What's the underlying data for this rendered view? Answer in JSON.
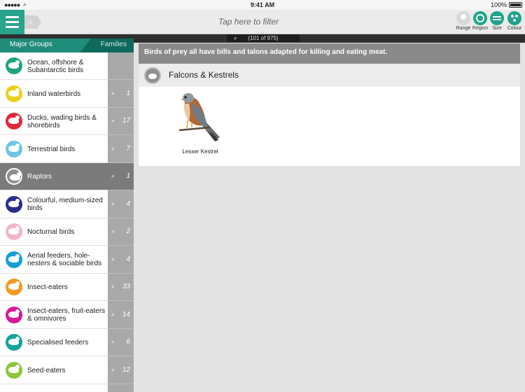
{
  "status_bar": {
    "carrier": "●●●●●",
    "time": "9:41 AM",
    "battery": "100%"
  },
  "toolbar": {
    "filter_placeholder": "Tap here to filter",
    "buttons": [
      {
        "label": "Range",
        "icon": "range-pin-icon"
      },
      {
        "label": "Region",
        "icon": "region-target-icon"
      },
      {
        "label": "Size",
        "icon": "size-bars-icon"
      },
      {
        "label": "Colour",
        "icon": "colour-palette-icon"
      }
    ]
  },
  "count": "(101 of 975)",
  "sidebar": {
    "tab_major": "Major Groups",
    "tab_families": "Families",
    "items": [
      {
        "label": "Ocean, offshore & Subantarctic birds",
        "count": "",
        "color": "#1fa37e",
        "selected": false
      },
      {
        "label": "Inland waterbirds",
        "count": "1",
        "color": "#e8d21c",
        "selected": false
      },
      {
        "label": "Ducks, wading birds & shorebirds",
        "count": "17",
        "color": "#e02a3a",
        "selected": false
      },
      {
        "label": "Terrestrial birds",
        "count": "7",
        "color": "#6fc3e8",
        "selected": false
      },
      {
        "label": "Raptors",
        "count": "1",
        "color": "#8f8f8f",
        "selected": true
      },
      {
        "label": "Colourful, medium-sized birds",
        "count": "4",
        "color": "#2b2c8c",
        "selected": false
      },
      {
        "label": "Nocturnal birds",
        "count": "2",
        "color": "#f3b5c6",
        "selected": false
      },
      {
        "label": "Aerial feeders, hole-nesters & sociable birds",
        "count": "4",
        "color": "#1a9ed8",
        "selected": false
      },
      {
        "label": "Insect-eaters",
        "count": "33",
        "color": "#f29a26",
        "selected": false
      },
      {
        "label": "Insect-eaters, fruit-eaters & omnivores",
        "count": "14",
        "color": "#d6189a",
        "selected": false
      },
      {
        "label": "Specialised feeders",
        "count": "6",
        "color": "#14a39a",
        "selected": false
      },
      {
        "label": "Seed-eaters",
        "count": "12",
        "color": "#8cc63f",
        "selected": false
      }
    ]
  },
  "main": {
    "description": "Birds of prey all have bills and talons adapted for killing and eating meat.",
    "family": "Falcons & Kestrels",
    "species": [
      {
        "name": "Lesser Kestrel"
      }
    ]
  }
}
